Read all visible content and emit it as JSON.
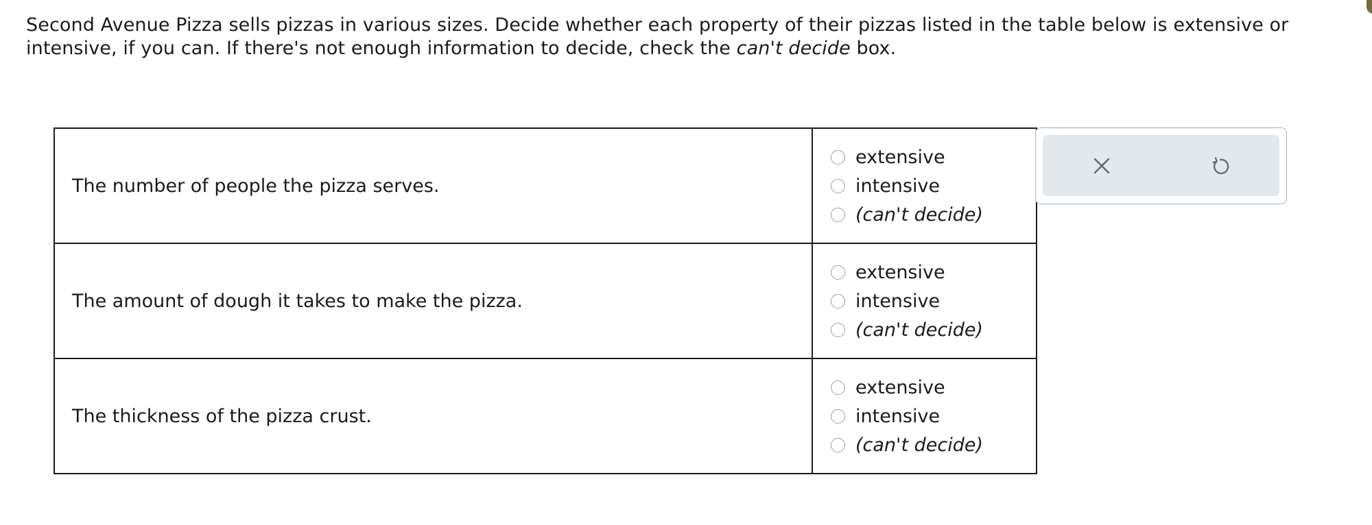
{
  "prompt": {
    "part1": "Second Avenue Pizza sells pizzas in various sizes. Decide whether each property of their pizzas listed in the table below is extensive or intensive, if you can. If there's not enough information to decide, check the ",
    "emphasis": "can't decide",
    "part2": " box."
  },
  "rows": [
    {
      "statement": "The number of people the pizza serves.",
      "options": [
        "extensive",
        "intensive",
        "(can't decide)"
      ]
    },
    {
      "statement": "The amount of dough it takes to make the pizza.",
      "options": [
        "extensive",
        "intensive",
        "(can't decide)"
      ]
    },
    {
      "statement": "The thickness of the pizza crust.",
      "options": [
        "extensive",
        "intensive",
        "(can't decide)"
      ]
    }
  ],
  "tools": {
    "clear_icon": "x-icon",
    "undo_icon": "undo-icon",
    "icon_color": "#5a6b78"
  }
}
